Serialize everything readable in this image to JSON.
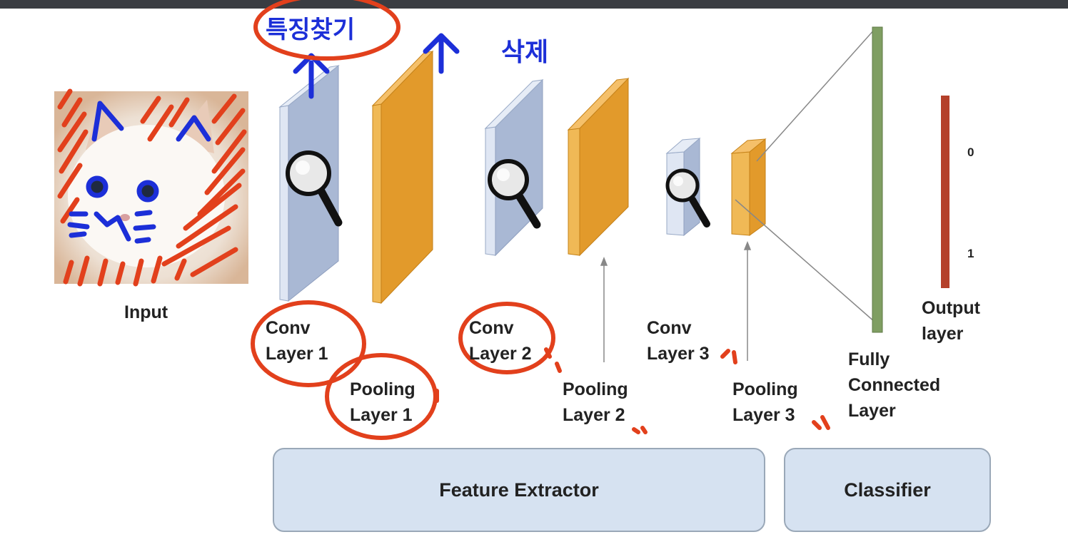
{
  "input_label": "Input",
  "layers": {
    "conv1": [
      "Conv",
      "Layer 1"
    ],
    "pool1": [
      "Pooling",
      "Layer 1"
    ],
    "conv2": [
      "Conv",
      "Layer 2"
    ],
    "pool2": [
      "Pooling",
      "Layer 2"
    ],
    "conv3": [
      "Conv",
      "Layer 3"
    ],
    "pool3": [
      "Pooling",
      "Layer 3"
    ],
    "fc": [
      "Fully",
      "Connected",
      "Layer"
    ],
    "output": [
      "Output",
      "layer"
    ]
  },
  "output_values": [
    "0",
    "1"
  ],
  "regions": {
    "feature_extractor": "Feature Extractor",
    "classifier": "Classifier"
  },
  "handwritten": {
    "find_features": "특징찾기",
    "delete": "삭제"
  },
  "colors": {
    "conv": "#a9b8d4",
    "pool": "#e29a2b",
    "fc": "#7f9e62",
    "output": "#b4402a",
    "ink_blue": "#1c2fd8",
    "ink_red": "#e2401c",
    "region": "#d6e2f1"
  },
  "icons": [
    "magnifier-icon",
    "cat-image"
  ]
}
